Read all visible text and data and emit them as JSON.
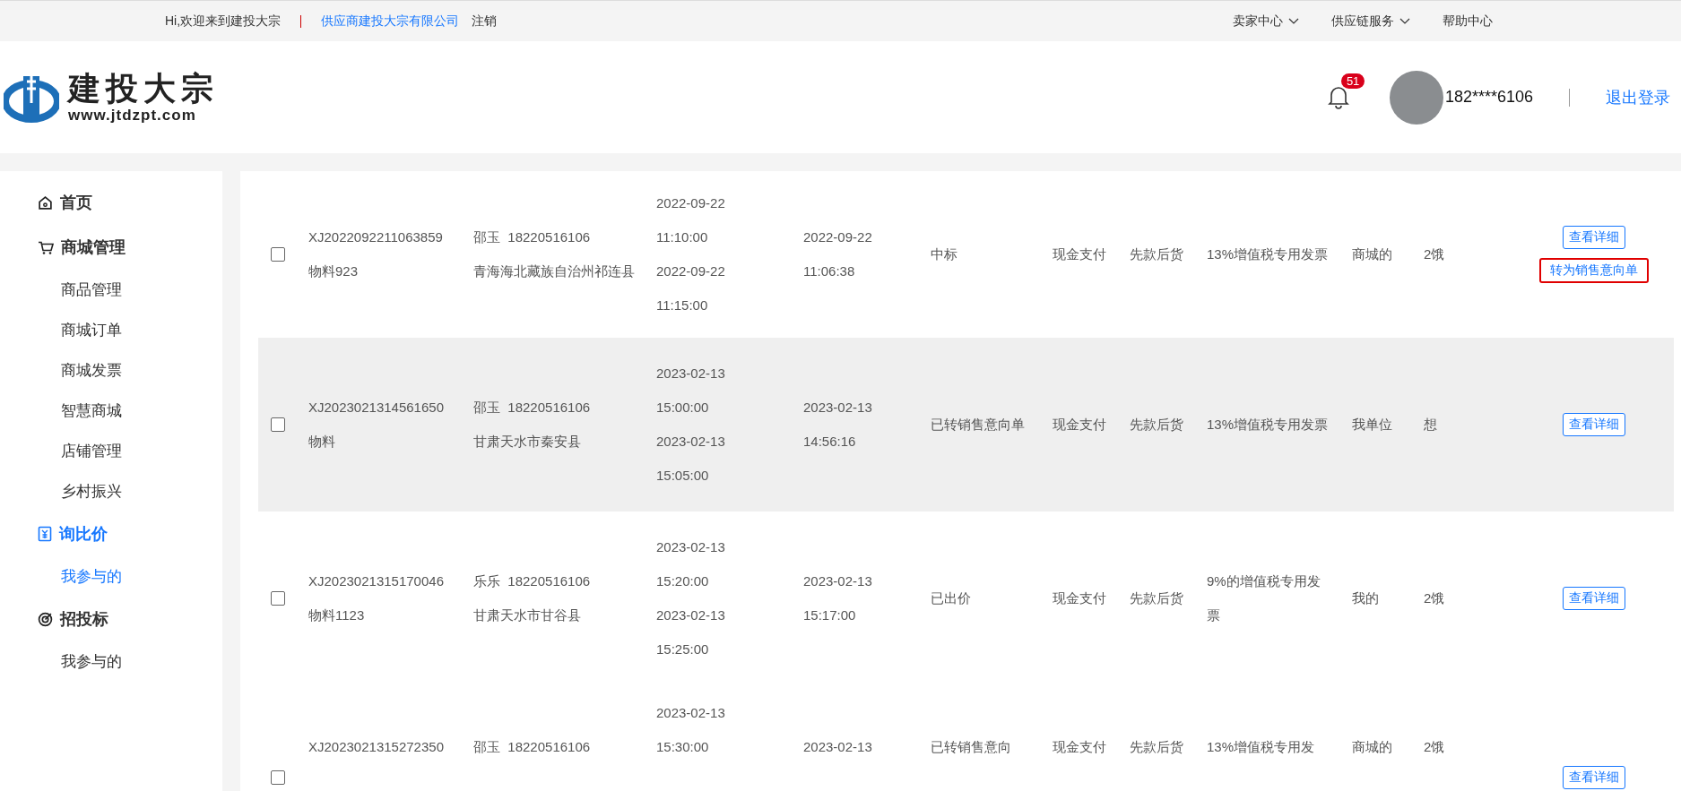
{
  "top_bar": {
    "welcome": "Hi,欢迎来到建投大宗",
    "company": "供应商建投大宗有限公司",
    "logout_link": "注销",
    "menus": [
      {
        "label": "卖家中心",
        "dropdown": true
      },
      {
        "label": "供应链服务",
        "dropdown": true
      },
      {
        "label": "帮助中心",
        "dropdown": false
      }
    ]
  },
  "header": {
    "logo_name": "建投大宗",
    "logo_url": "www.jtdzpt.com",
    "notification_count": "51",
    "user": "182****6106",
    "logout": "退出登录"
  },
  "sidebar": {
    "groups": [
      {
        "label": "首页",
        "kind": "home",
        "selected": false
      },
      {
        "label": "商城管理",
        "kind": "cart",
        "selected": false,
        "children": [
          {
            "label": "商品管理",
            "selected": false
          },
          {
            "label": "商城订单",
            "selected": false
          },
          {
            "label": "商城发票",
            "selected": false
          },
          {
            "label": "智慧商城",
            "selected": false
          },
          {
            "label": "店铺管理",
            "selected": false
          },
          {
            "label": "乡村振兴",
            "selected": false
          }
        ]
      },
      {
        "label": "询比价",
        "kind": "quote",
        "selected": true,
        "children": [
          {
            "label": "我参与的",
            "selected": true
          }
        ]
      },
      {
        "label": "招投标",
        "kind": "target",
        "selected": false,
        "children": [
          {
            "label": "我参与的",
            "selected": false
          }
        ]
      }
    ]
  },
  "rows": [
    {
      "checked": false,
      "shaded": false,
      "code": "XJ2022092211063859",
      "material": "物料923",
      "contact": "邵玉  18220516106",
      "address": "青海海北藏族自治州祁连县",
      "start": [
        "2022-09-22",
        "11:10:00"
      ],
      "end": [
        "2022-09-22",
        "11:15:00"
      ],
      "created": [
        "2022-09-22",
        "11:06:38"
      ],
      "status": "中标",
      "payment": "现金支付",
      "delivery": "先款后货",
      "invoice": "13%增值税专用发票",
      "unit": "商城的",
      "note": "2饿",
      "actions": [
        {
          "label": "查看详细",
          "highlighted": false
        },
        {
          "label": "转为销售意向单",
          "highlighted": true
        }
      ]
    },
    {
      "checked": false,
      "shaded": true,
      "code": "XJ2023021314561650",
      "material": "物料",
      "contact": "邵玉  18220516106",
      "address": "甘肃天水市秦安县",
      "start": [
        "2023-02-13",
        "15:00:00"
      ],
      "end": [
        "2023-02-13",
        "15:05:00"
      ],
      "created": [
        "2023-02-13",
        "14:56:16"
      ],
      "status": "已转销售意向单",
      "payment": "现金支付",
      "delivery": "先款后货",
      "invoice": "13%增值税专用发票",
      "unit": "我单位",
      "note": "想",
      "actions": [
        {
          "label": "查看详细",
          "highlighted": false
        }
      ]
    },
    {
      "checked": false,
      "shaded": false,
      "code": "XJ2023021315170046",
      "material": "物料1123",
      "contact": "乐乐  18220516106",
      "address": "甘肃天水市甘谷县",
      "start": [
        "2023-02-13",
        "15:20:00"
      ],
      "end": [
        "2023-02-13",
        "15:25:00"
      ],
      "created": [
        "2023-02-13",
        "15:17:00"
      ],
      "status": "已出价",
      "payment": "现金支付",
      "delivery": "先款后货",
      "invoice": "9%的增值税专用发票",
      "unit": "我的",
      "note": "2饿",
      "actions": [
        {
          "label": "查看详细",
          "highlighted": false
        }
      ]
    },
    {
      "checked": false,
      "shaded": false,
      "code": "XJ2023021315272350",
      "contact": "邵玉  18220516106",
      "start": [
        "2023-02-13",
        "15:30:00"
      ],
      "created": [
        "2023-02-13"
      ],
      "status": "已转销售意向",
      "payment": "现金支付",
      "delivery": "先款后货",
      "invoice": "13%增值税专用发",
      "unit": "商城的",
      "note": "2饿",
      "actions": [
        {
          "label": "查看详细",
          "highlighted": false
        }
      ]
    }
  ]
}
